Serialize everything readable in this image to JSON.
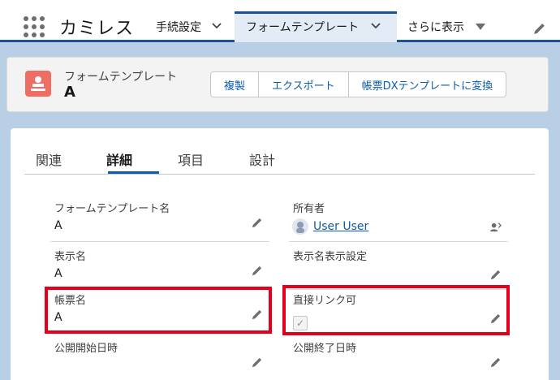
{
  "top_nav": {
    "app_name": "カミレス",
    "items": [
      {
        "label": "手続設定",
        "has_menu": true
      },
      {
        "label": "フォームテンプレート",
        "has_menu": true,
        "active": true
      },
      {
        "label": "さらに表示",
        "has_menu": true
      }
    ],
    "icons": [
      "app-launcher-icon",
      "chevron-down-icon",
      "pencil-icon"
    ]
  },
  "header": {
    "object_type": "フォームテンプレート",
    "record_name": "A",
    "icon": "form-template-icon",
    "icon_color": "#ef6e64",
    "actions": [
      "複製",
      "エクスポート",
      "帳票DXテンプレートに変換"
    ]
  },
  "tabs": {
    "items": [
      "関連",
      "詳細",
      "項目",
      "設計"
    ],
    "active": "詳細"
  },
  "fields": {
    "form_template_name": {
      "label": "フォームテンプレート名",
      "value": "A"
    },
    "owner": {
      "label": "所有者",
      "value": "User User"
    },
    "display_name": {
      "label": "表示名",
      "value": "A"
    },
    "display_name_setting": {
      "label": "表示名表示設定",
      "value": ""
    },
    "document_name": {
      "label": "帳票名",
      "value": "A"
    },
    "direct_link": {
      "label": "直接リンク可",
      "value": "✓",
      "checked": true
    },
    "publish_start": {
      "label": "公開開始日時",
      "value": ""
    },
    "publish_end": {
      "label": "公開終了日時",
      "value": ""
    }
  },
  "colors": {
    "brand_blue": "#1b5297",
    "link_blue": "#0b5cab",
    "highlight_red": "#e4001b",
    "background": "#b9cfe6"
  }
}
